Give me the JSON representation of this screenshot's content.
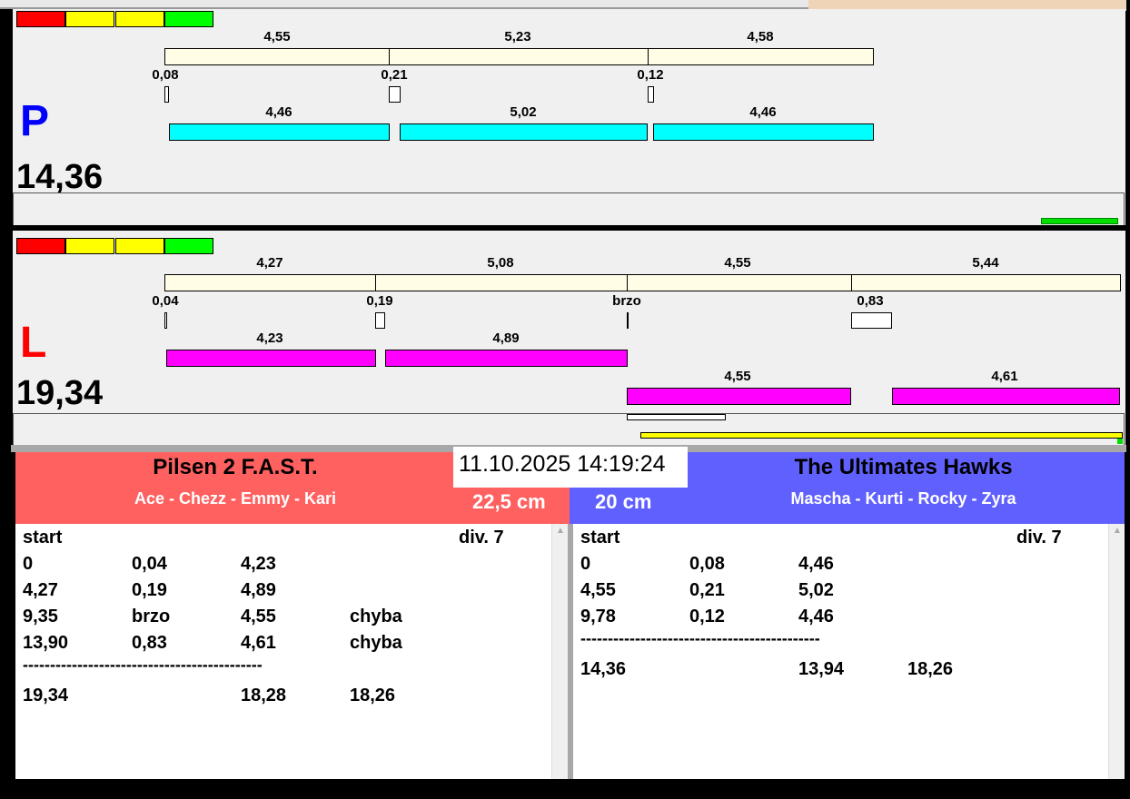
{
  "colors": {
    "red": "#ff0000",
    "yellow": "#ffff00",
    "green": "#00ff00",
    "team_left": "#ff6060",
    "team_right": "#6060ff",
    "lane_p": "#0000ff",
    "lane_l": "#ff0000"
  },
  "lane_p": {
    "letter": "P",
    "total": "14,36",
    "run_times": [
      "4,55",
      "5,23",
      "4,58"
    ],
    "reactions": [
      "0,08",
      "0,21",
      "0,12"
    ],
    "dog_times": [
      "4,46",
      "5,02",
      "4,46"
    ]
  },
  "lane_l": {
    "letter": "L",
    "total": "19,34",
    "run_times": [
      "4,27",
      "5,08",
      "4,55",
      "5,44"
    ],
    "reactions": [
      "0,04",
      "0,19",
      "brzo",
      "0,83"
    ],
    "dog_times": [
      "4,23",
      "4,89",
      "4,55",
      "4,61"
    ]
  },
  "datetime": "11.10.2025 14:19:24",
  "left_team": {
    "name": "Pilsen 2 F.A.S.T.",
    "dogs": "Ace - Chezz - Emmy - Kari",
    "height": "22,5 cm",
    "start": "start",
    "div": "div.  7",
    "rows": [
      [
        "0",
        "0,04",
        "4,23",
        ""
      ],
      [
        "4,27",
        "0,19",
        "4,89",
        ""
      ],
      [
        "9,35",
        "brzo",
        "4,55",
        "chyba"
      ],
      [
        "13,90",
        "0,83",
        "4,61",
        "chyba"
      ]
    ],
    "separator": "--------------------------------------------",
    "totals": [
      "19,34",
      "",
      "18,28",
      "18,26"
    ]
  },
  "right_team": {
    "name": "The Ultimates Hawks",
    "dogs": "Mascha - Kurti - Rocky - Zyra",
    "height": "20 cm",
    "start": "start",
    "div": "div.  7",
    "rows": [
      [
        "0",
        "0,08",
        "4,46",
        ""
      ],
      [
        "4,55",
        "0,21",
        "5,02",
        ""
      ],
      [
        "9,78",
        "0,12",
        "4,46",
        ""
      ]
    ],
    "separator": "--------------------------------------------",
    "totals": [
      "14,36",
      "",
      "13,94",
      "18,26"
    ]
  }
}
